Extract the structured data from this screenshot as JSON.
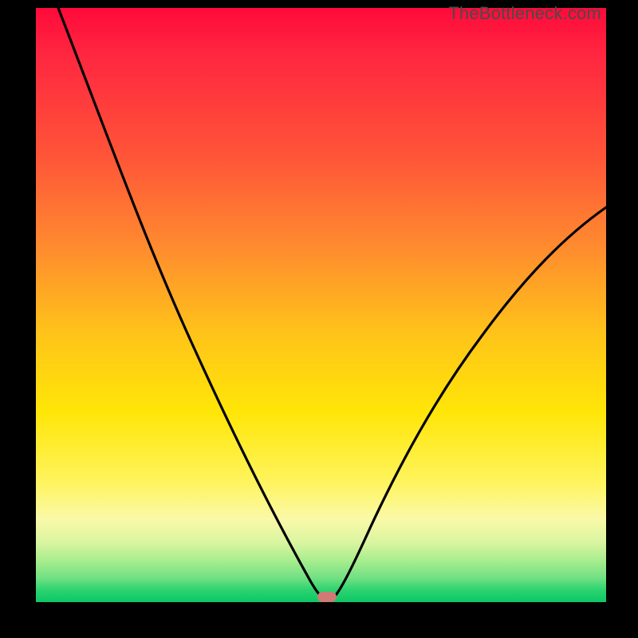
{
  "watermark": "TheBottleneck.com",
  "chart_data": {
    "type": "line",
    "title": "",
    "xlabel": "",
    "ylabel": "",
    "xlim": [
      0,
      100
    ],
    "ylim": [
      0,
      100
    ],
    "grid": false,
    "legend": false,
    "annotations": [],
    "background_gradient": {
      "orientation": "vertical",
      "stops": [
        {
          "pos": 0,
          "color": "#ff0a3a"
        },
        {
          "pos": 50,
          "color": "#ffc419"
        },
        {
          "pos": 85,
          "color": "#fff45f"
        },
        {
          "pos": 100,
          "color": "#0cc766"
        }
      ]
    },
    "marker": {
      "x": 51,
      "y": 0,
      "color": "#cf7a74"
    },
    "series": [
      {
        "name": "curve",
        "color": "#000000",
        "x": [
          4,
          10,
          16,
          22,
          28,
          34,
          40,
          45,
          48,
          50,
          51,
          52,
          55,
          60,
          66,
          74,
          82,
          90,
          100
        ],
        "values": [
          100,
          86,
          73,
          61,
          50,
          40,
          30,
          20,
          10,
          3,
          0,
          4,
          12,
          24,
          38,
          52,
          62,
          70,
          78
        ]
      }
    ]
  }
}
